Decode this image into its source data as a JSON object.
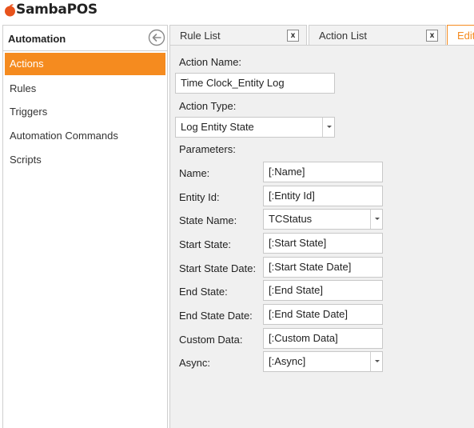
{
  "app": {
    "logo_text": "SambaPOS"
  },
  "sidebar": {
    "title": "Automation",
    "items": [
      {
        "label": "Actions",
        "active": true
      },
      {
        "label": "Rules",
        "active": false
      },
      {
        "label": "Triggers",
        "active": false
      },
      {
        "label": "Automation Commands",
        "active": false
      },
      {
        "label": "Scripts",
        "active": false
      }
    ]
  },
  "tabs": [
    {
      "label": "Rule List",
      "close": "x"
    },
    {
      "label": "Action List",
      "close": "x"
    },
    {
      "label": "Edit",
      "active": true
    }
  ],
  "editor": {
    "action_name_label": "Action Name:",
    "action_name_value": "Time Clock_Entity Log",
    "action_type_label": "Action Type:",
    "action_type_value": "Log Entity State",
    "parameters_label": "Parameters:",
    "params": [
      {
        "label": "Name:",
        "value": "[:Name]",
        "dropdown": false
      },
      {
        "label": "Entity Id:",
        "value": "[:Entity Id]",
        "dropdown": false
      },
      {
        "label": "State Name:",
        "value": "TCStatus",
        "dropdown": true
      },
      {
        "label": "Start State:",
        "value": "[:Start State]",
        "dropdown": false
      },
      {
        "label": "Start State Date:",
        "value": "[:Start State Date]",
        "dropdown": false
      },
      {
        "label": "End State:",
        "value": "[:End State]",
        "dropdown": false
      },
      {
        "label": "End State Date:",
        "value": "[:End State Date]",
        "dropdown": false
      },
      {
        "label": "Custom Data:",
        "value": "[:Custom Data]",
        "dropdown": false
      },
      {
        "label": "Async:",
        "value": "[:Async]",
        "dropdown": true
      }
    ]
  },
  "colors": {
    "accent": "#f58b1f",
    "panel_bg": "#f0f0f0",
    "border": "#cfcfcf"
  }
}
